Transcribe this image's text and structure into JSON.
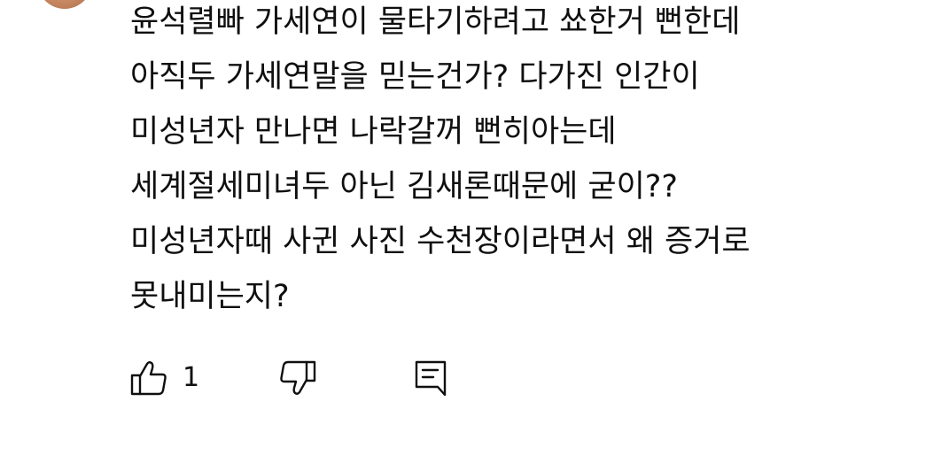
{
  "comment": {
    "lines": [
      "윤석렬빠 가세연이 물타기하려고 쑈한거 뻔한데",
      "아직두 가세연말을 믿는건가?  다가진 인간이",
      "미성년자 만나면 나락갈꺼 뻔히아는데",
      "세계절세미녀두 아닌 김새론때문에 굳이??",
      "미성년자때 사귄 사진 수천장이라면서 왜 증거로",
      "못내미는지?"
    ]
  },
  "actions": {
    "like_icon": "thumbs-up-icon",
    "like_count": "1",
    "dislike_icon": "thumbs-down-icon",
    "reply_icon": "reply-comment-icon"
  }
}
